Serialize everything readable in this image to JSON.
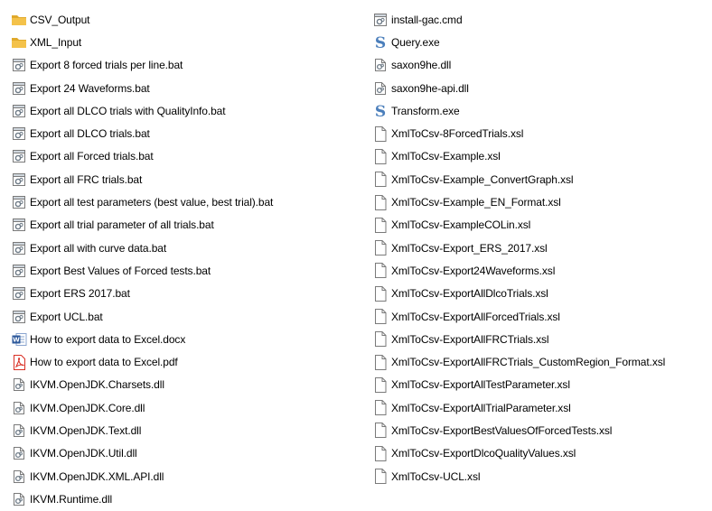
{
  "columns": [
    {
      "items": [
        {
          "label": "CSV_Output",
          "icon": "folder-icon"
        },
        {
          "label": "XML_Input",
          "icon": "folder-icon"
        },
        {
          "label": "Export 8 forced trials per line.bat",
          "icon": "batch-file-icon"
        },
        {
          "label": "Export 24 Waveforms.bat",
          "icon": "batch-file-icon"
        },
        {
          "label": "Export all DLCO trials with QualityInfo.bat",
          "icon": "batch-file-icon"
        },
        {
          "label": "Export all DLCO trials.bat",
          "icon": "batch-file-icon"
        },
        {
          "label": "Export all Forced trials.bat",
          "icon": "batch-file-icon"
        },
        {
          "label": "Export all FRC trials.bat",
          "icon": "batch-file-icon"
        },
        {
          "label": "Export all test parameters (best value, best trial).bat",
          "icon": "batch-file-icon"
        },
        {
          "label": "Export all trial parameter of all trials.bat",
          "icon": "batch-file-icon"
        },
        {
          "label": "Export all with curve data.bat",
          "icon": "batch-file-icon"
        },
        {
          "label": "Export Best Values of Forced tests.bat",
          "icon": "batch-file-icon"
        },
        {
          "label": "Export ERS 2017.bat",
          "icon": "batch-file-icon"
        },
        {
          "label": "Export UCL.bat",
          "icon": "batch-file-icon"
        },
        {
          "label": "How to export data to Excel.docx",
          "icon": "word-document-icon"
        },
        {
          "label": "How to export data to Excel.pdf",
          "icon": "pdf-document-icon"
        },
        {
          "label": "IKVM.OpenJDK.Charsets.dll",
          "icon": "dll-file-icon"
        },
        {
          "label": "IKVM.OpenJDK.Core.dll",
          "icon": "dll-file-icon"
        },
        {
          "label": "IKVM.OpenJDK.Text.dll",
          "icon": "dll-file-icon"
        },
        {
          "label": "IKVM.OpenJDK.Util.dll",
          "icon": "dll-file-icon"
        },
        {
          "label": "IKVM.OpenJDK.XML.API.dll",
          "icon": "dll-file-icon"
        },
        {
          "label": "IKVM.Runtime.dll",
          "icon": "dll-file-icon"
        }
      ]
    },
    {
      "items": [
        {
          "label": "install-gac.cmd",
          "icon": "batch-file-icon"
        },
        {
          "label": "Query.exe",
          "icon": "saxon-exe-icon"
        },
        {
          "label": "saxon9he.dll",
          "icon": "dll-file-icon"
        },
        {
          "label": "saxon9he-api.dll",
          "icon": "dll-file-icon"
        },
        {
          "label": "Transform.exe",
          "icon": "saxon-exe-icon"
        },
        {
          "label": "XmlToCsv-8ForcedTrials.xsl",
          "icon": "blank-file-icon"
        },
        {
          "label": "XmlToCsv-Example.xsl",
          "icon": "blank-file-icon"
        },
        {
          "label": "XmlToCsv-Example_ConvertGraph.xsl",
          "icon": "blank-file-icon"
        },
        {
          "label": "XmlToCsv-Example_EN_Format.xsl",
          "icon": "blank-file-icon"
        },
        {
          "label": "XmlToCsv-ExampleCOLin.xsl",
          "icon": "blank-file-icon"
        },
        {
          "label": "XmlToCsv-Export_ERS_2017.xsl",
          "icon": "blank-file-icon"
        },
        {
          "label": "XmlToCsv-Export24Waveforms.xsl",
          "icon": "blank-file-icon"
        },
        {
          "label": "XmlToCsv-ExportAllDlcoTrials.xsl",
          "icon": "blank-file-icon"
        },
        {
          "label": "XmlToCsv-ExportAllForcedTrials.xsl",
          "icon": "blank-file-icon"
        },
        {
          "label": "XmlToCsv-ExportAllFRCTrials.xsl",
          "icon": "blank-file-icon"
        },
        {
          "label": "XmlToCsv-ExportAllFRCTrials_CustomRegion_Format.xsl",
          "icon": "blank-file-icon"
        },
        {
          "label": "XmlToCsv-ExportAllTestParameter.xsl",
          "icon": "blank-file-icon"
        },
        {
          "label": "XmlToCsv-ExportAllTrialParameter.xsl",
          "icon": "blank-file-icon"
        },
        {
          "label": "XmlToCsv-ExportBestValuesOfForcedTests.xsl",
          "icon": "blank-file-icon"
        },
        {
          "label": "XmlToCsv-ExportDlcoQualityValues.xsl",
          "icon": "blank-file-icon"
        },
        {
          "label": "XmlToCsv-UCL.xsl",
          "icon": "blank-file-icon"
        }
      ]
    }
  ],
  "colors": {
    "folder": "#F4C24A",
    "folder_dark": "#E0A92B",
    "file_border": "#7A7A7A",
    "gear": "#6D7A86",
    "word_blue": "#2B579A",
    "pdf_red": "#D93025",
    "saxon_blue": "#4A7EBB"
  }
}
